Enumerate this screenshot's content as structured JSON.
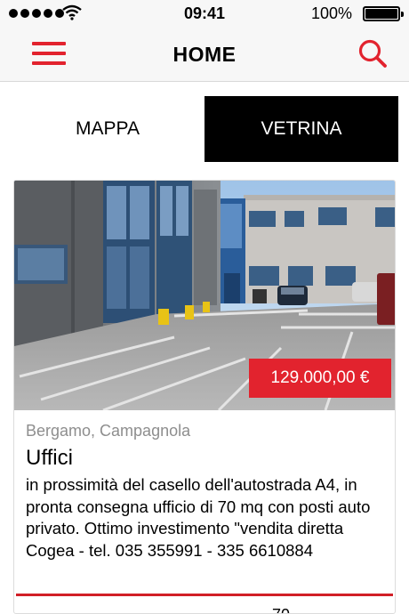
{
  "status_bar": {
    "time": "09:41",
    "battery": "100%",
    "signal_icon": "signal-dots-icon",
    "wifi_icon": "wifi-icon",
    "battery_icon": "battery-icon"
  },
  "nav": {
    "title": "HOME",
    "menu_icon": "hamburger-menu-icon",
    "search_icon": "search-icon",
    "accent_color": "#e2232e"
  },
  "tabs": [
    {
      "label": "MAPPA",
      "selected": false
    },
    {
      "label": "VETRINA",
      "selected": true
    }
  ],
  "listing": {
    "price": "129.000,00 €",
    "location": "Bergamo, Campagnola",
    "title": "Uffici",
    "description": "in prossimità del casello dell'autostrada A4, in pronta consegna ufficio di 70 mq con posti auto privato. Ottimo investimento \"vendita diretta Cogea - tel. 035 355991 - 335 6610884",
    "image": "office-building-parking-photo"
  },
  "next_listing_peek": "70"
}
